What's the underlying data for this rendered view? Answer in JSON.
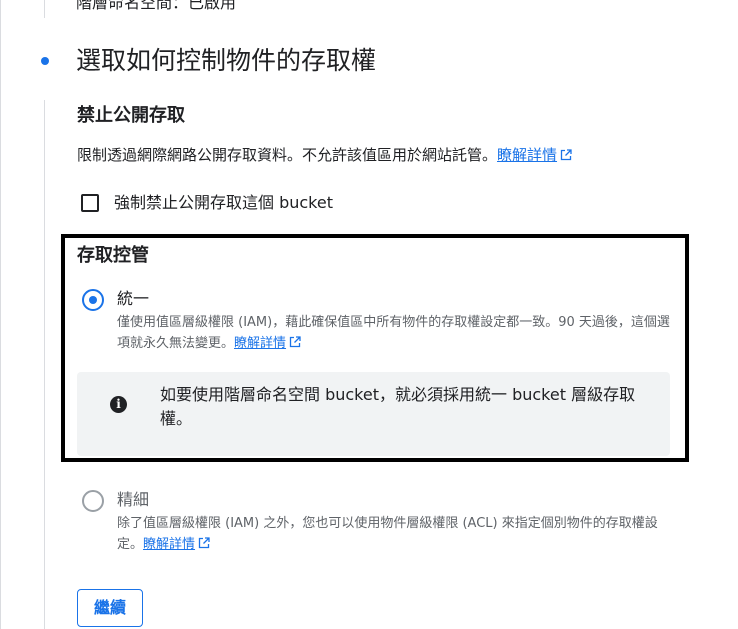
{
  "previous_step": {
    "status": "階層命名空間：已啟用"
  },
  "step": {
    "title": "選取如何控制物件的存取權"
  },
  "public_access": {
    "title": "禁止公開存取",
    "description": "限制透過網際網路公開存取資料。不允許該值區用於網站託管。",
    "learn_more": "瞭解詳情",
    "checkbox_label": "強制禁止公開存取這個 bucket",
    "checkbox_checked": false
  },
  "access_control": {
    "title": "存取控管",
    "options": [
      {
        "label": "統一",
        "selected": true,
        "description": "僅使用值區層級權限 (IAM)，藉此確保值區中所有物件的存取權設定都一致。90 天過後，這個選項就永久無法變更。",
        "learn_more": "瞭解詳情"
      },
      {
        "label": "精細",
        "selected": false,
        "description": "除了值區層級權限 (IAM) 之外，您也可以使用物件層級權限 (ACL) 來指定個別物件的存取權設定。",
        "learn_more": "瞭解詳情"
      }
    ],
    "info_icon": "info-icon",
    "info_message": "如要使用階層命名空間 bucket，就必須採用統一 bucket 層級存取權。"
  },
  "continue_button": {
    "label": "繼續"
  },
  "colors": {
    "accent": "#1a73e8",
    "text": "#202124",
    "muted_text": "#5f6368",
    "info_background": "#f1f3f4",
    "highlight_border": "#000000"
  }
}
